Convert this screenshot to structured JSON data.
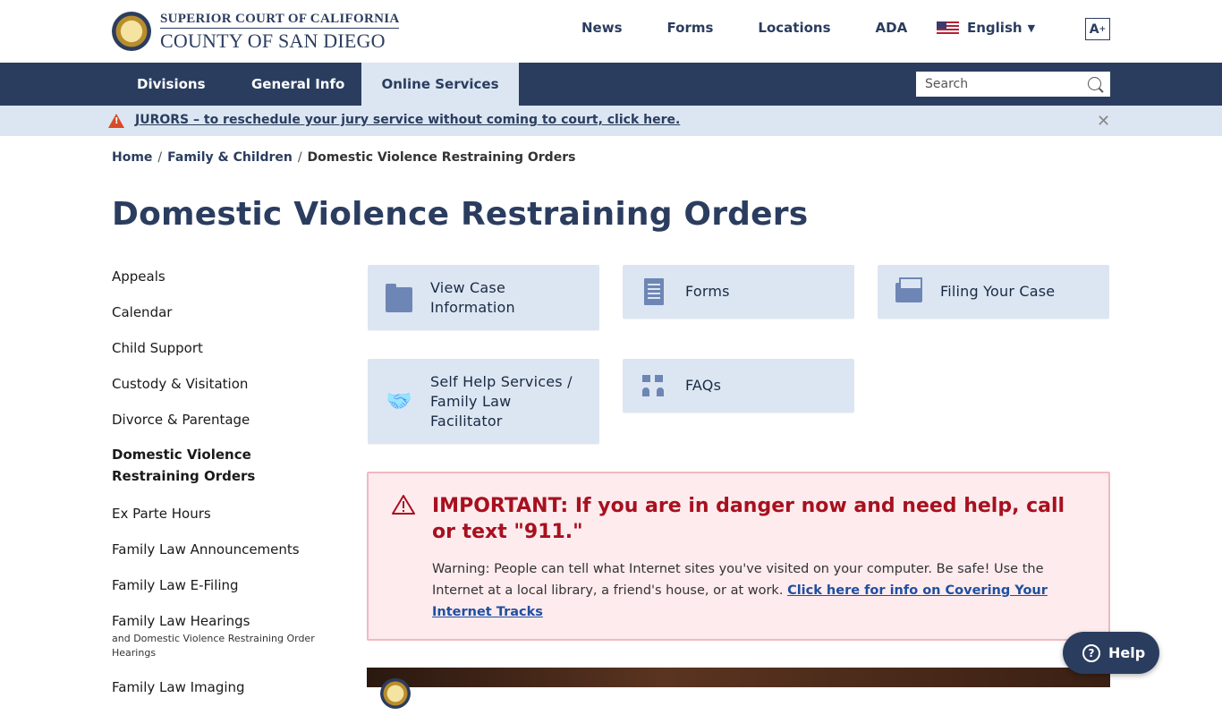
{
  "header": {
    "logo_line1": "SUPERIOR COURT OF CALIFORNIA",
    "logo_line2": "COUNTY OF SAN DIEGO",
    "top_links": [
      "News",
      "Forms",
      "Locations",
      "ADA"
    ],
    "language": "English",
    "text_size_label": "A",
    "text_size_sup": "+"
  },
  "main_nav": {
    "tabs": [
      "Divisions",
      "General Info",
      "Online Services"
    ],
    "active_tab": "Online Services",
    "search_placeholder": "Search"
  },
  "alert": {
    "icon_glyph": "!",
    "text": "JURORS – to reschedule your jury service without coming to court, click here.",
    "close": "✕"
  },
  "breadcrumb": {
    "items": [
      "Home",
      "Family & Children",
      "Domestic Violence Restraining Orders"
    ],
    "separator": "/"
  },
  "page_title": "Domestic Violence Restraining Orders",
  "sidebar": {
    "items": [
      {
        "label": "Appeals"
      },
      {
        "label": "Calendar"
      },
      {
        "label": "Child Support"
      },
      {
        "label": "Custody & Visitation"
      },
      {
        "label": "Divorce & Parentage"
      },
      {
        "label": "Domestic Violence Restraining Orders",
        "active": true
      },
      {
        "label": "Ex Parte Hours"
      },
      {
        "label": "Family Law Announcements"
      },
      {
        "label": "Family Law E-Filing"
      },
      {
        "label": "Family Law Hearings",
        "sub": "and Domestic Violence Restraining Order Hearings"
      },
      {
        "label": "Family Law Imaging"
      }
    ]
  },
  "cards": [
    {
      "label": "View Case Information",
      "icon": "folder-icon"
    },
    {
      "label": "Forms",
      "icon": "document-icon"
    },
    {
      "label": "Filing Your Case",
      "icon": "filing-box-icon"
    },
    {
      "label": "Self Help Services / Family Law Facilitator",
      "icon": "handshake-icon"
    },
    {
      "label": "FAQs",
      "icon": "faq-people-icon"
    }
  ],
  "important": {
    "title": "IMPORTANT: If you are in danger now and need help, call or text \"911.\"",
    "body": "Warning: People can tell what Internet sites you've visited on your computer. Be safe! Use the Internet at a local library, a friend's house, or at work.",
    "link": "Click here for info on Covering Your Internet Tracks"
  },
  "help_button": {
    "label": "Help",
    "icon_glyph": "?"
  },
  "colors": {
    "navy": "#2b3d5f",
    "light_blue": "#dce6f2",
    "alert_red": "#a8101e",
    "alert_bg": "#fdebee"
  }
}
